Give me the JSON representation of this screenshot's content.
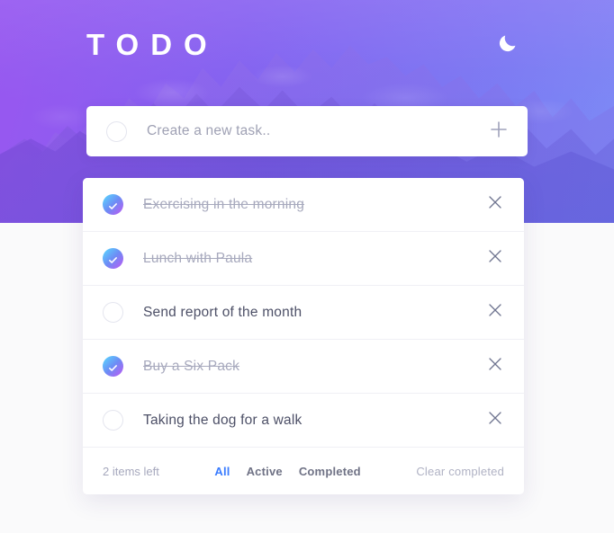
{
  "header": {
    "title": "TODO",
    "theme_toggle_icon": "moon-icon"
  },
  "new_task": {
    "placeholder": "Create a new task..",
    "value": "",
    "add_icon": "plus-icon",
    "checkbox_icon": "empty-circle-icon"
  },
  "tasks": [
    {
      "label": "Exercising in the morning",
      "completed": true,
      "delete_icon": "close-icon"
    },
    {
      "label": "Lunch with Paula",
      "completed": true,
      "delete_icon": "close-icon"
    },
    {
      "label": "Send report of the month",
      "completed": false,
      "delete_icon": "close-icon"
    },
    {
      "label": "Buy a Six Pack",
      "completed": true,
      "delete_icon": "close-icon"
    },
    {
      "label": "Taking the dog for a walk",
      "completed": false,
      "delete_icon": "close-icon"
    }
  ],
  "footer": {
    "items_left": "2 items left",
    "filters": [
      {
        "label": "All",
        "active": true
      },
      {
        "label": "Active",
        "active": false
      },
      {
        "label": "Completed",
        "active": false
      }
    ],
    "clear_label": "Clear completed"
  },
  "colors": {
    "accent_blue": "#3a7cff",
    "check_gradient_start": "#57ddff",
    "check_gradient_end": "#c058f3",
    "header_purple": "#8b5cf6",
    "header_blue": "#8290f5",
    "text_dark": "#4d5067",
    "text_muted": "#a6a8bd"
  }
}
